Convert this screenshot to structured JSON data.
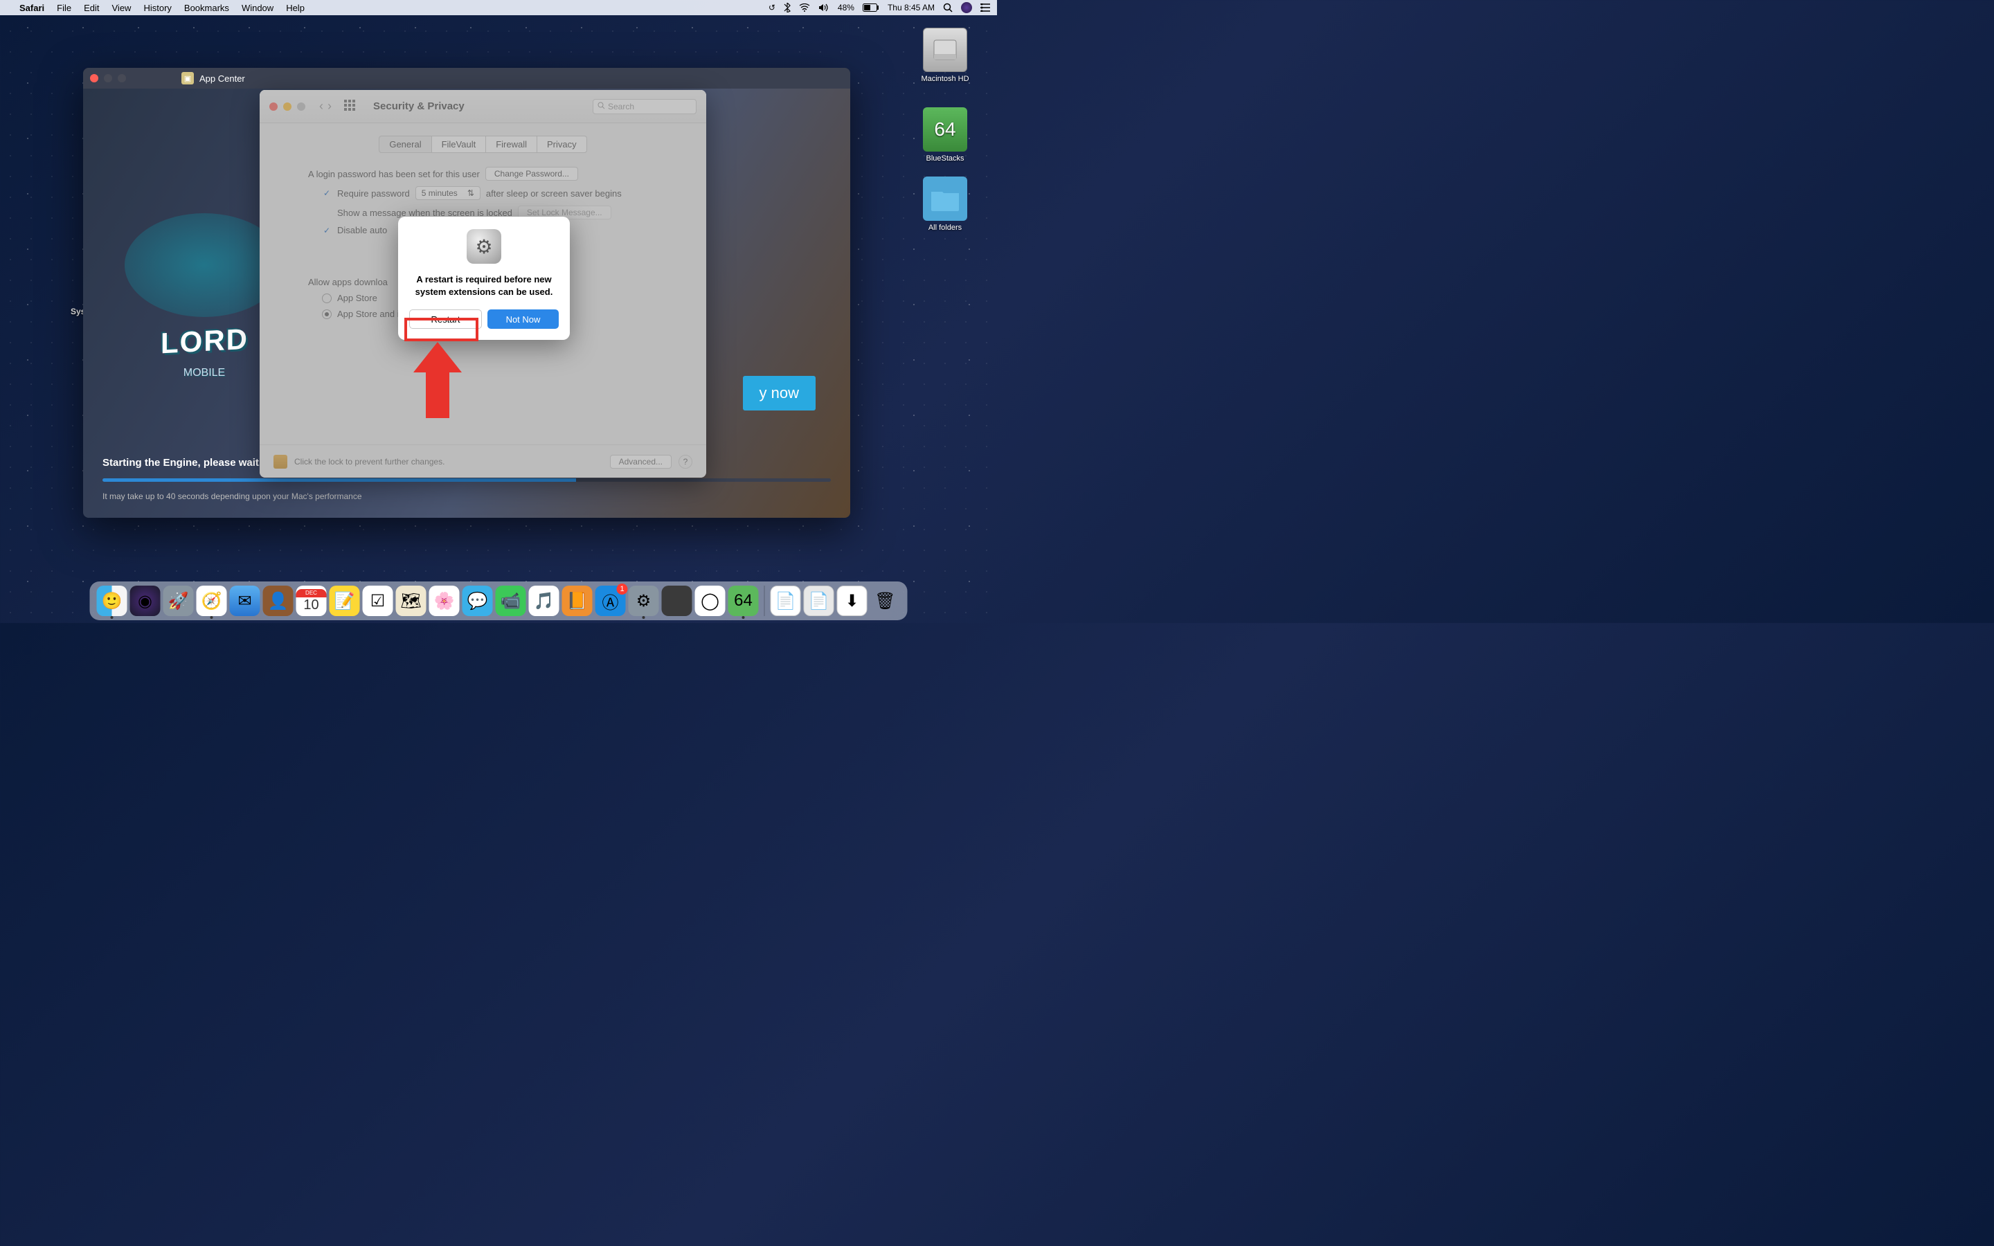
{
  "menubar": {
    "app": "Safari",
    "items": [
      "File",
      "Edit",
      "View",
      "History",
      "Bookmarks",
      "Window",
      "Help"
    ],
    "battery_pct": "48%",
    "clock": "Thu 8:45 AM"
  },
  "desktop": {
    "hd": "Macintosh HD",
    "bluestacks": "BlueStacks",
    "allfolders": "All folders",
    "truncated": "Sys"
  },
  "appcenter": {
    "title": "App Center",
    "playnow": "y now",
    "status_title": "Starting the Engine, please wait...",
    "status_sub": "It may take up to 40 seconds depending upon your Mac's performance",
    "lords": "LORD",
    "lords_sub": "MOBILE"
  },
  "secpriv": {
    "title": "Security & Privacy",
    "search_placeholder": "Search",
    "tabs": {
      "general": "General",
      "filevault": "FileVault",
      "firewall": "Firewall",
      "privacy": "Privacy"
    },
    "line_login": "A login password has been set for this user",
    "btn_change": "Change Password...",
    "chk_require": "Require password",
    "sel_delay": "5 minutes",
    "after_sleep": "after sleep or screen saver begins",
    "chk_show": "Show a message when the screen is locked",
    "btn_setlock": "Set Lock Message...",
    "chk_disable": "Disable auto",
    "allow_label": "Allow apps downloa",
    "radio_appstore": "App Store",
    "radio_identified": "App Store and identified developers",
    "lock_text": "Click the lock to prevent further changes.",
    "advanced": "Advanced...",
    "help": "?"
  },
  "modal": {
    "text_l1": "A restart is required before new",
    "text_l2": "system extensions can be used.",
    "restart": "Restart",
    "notnow": "Not Now"
  },
  "dock": {
    "appstore_badge": "1",
    "cal_month": "DEC",
    "cal_day": "10"
  }
}
